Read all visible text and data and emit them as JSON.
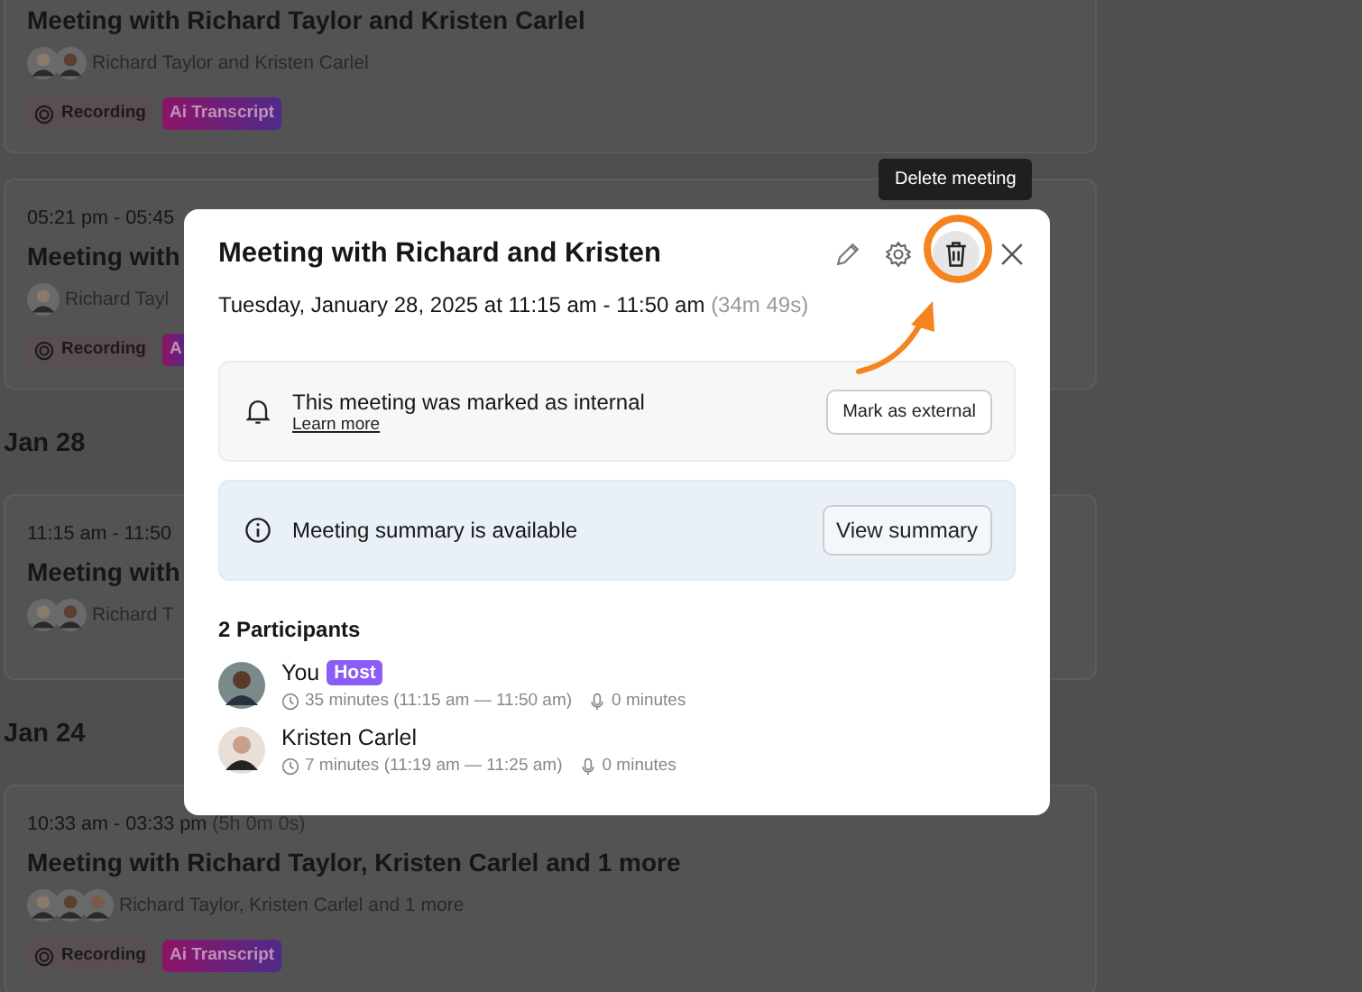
{
  "groups": [
    {
      "cards": [
        {
          "title": "Meeting with Richard Taylor and Kristen Carlel",
          "names": "Richard Taylor and Kristen Carlel",
          "avatars": [
            {
              "kind": "picture"
            },
            {
              "kind": "picture"
            }
          ],
          "tags": [
            {
              "kind": "recording",
              "label": "Recording"
            },
            {
              "kind": "transcript",
              "label": "Ai Transcript"
            }
          ]
        },
        {
          "time": "05:21 pm - 05:45",
          "title": "Meeting with",
          "names": "Richard Tayl",
          "avatars": [
            {
              "kind": "picture"
            }
          ],
          "tags": [
            {
              "kind": "recording",
              "label": "Recording"
            },
            {
              "kind": "transcript",
              "label": "A"
            }
          ]
        }
      ]
    },
    {
      "date": "Jan 28",
      "cards": [
        {
          "time": "11:15 am - 11:50",
          "title": "Meeting with",
          "names": "Richard T",
          "avatars": [
            {
              "kind": "picture"
            },
            {
              "kind": "picture"
            }
          ]
        }
      ]
    },
    {
      "date": "Jan 24",
      "cards": [
        {
          "time": "10:33 am - 03:33 pm",
          "duration": "(5h 0m 0s)",
          "title": "Meeting with Richard Taylor, Kristen Carlel and 1 more",
          "names": "Richard Taylor, Kristen Carlel and 1 more",
          "avatars": [
            {
              "kind": "picture"
            },
            {
              "kind": "picture"
            },
            {
              "kind": "picture"
            }
          ],
          "tags": [
            {
              "kind": "recording",
              "label": "Recording"
            },
            {
              "kind": "transcript",
              "label": "Ai Transcript"
            }
          ]
        }
      ]
    }
  ],
  "dialog": {
    "title": "Meeting with Richard and Kristen",
    "date": "Tuesday, January 28, 2025 at 11:15 am - 11:50 am",
    "duration": "(34m 49s)",
    "actions": [
      {
        "kind": "edit",
        "hovered": false
      },
      {
        "kind": "settings",
        "hovered": false
      },
      {
        "kind": "delete",
        "hovered": true
      },
      {
        "kind": "close",
        "hovered": false
      }
    ],
    "tooltip": "Delete meeting",
    "notices": [
      {
        "kind": "internal",
        "text": "This meeting was marked as internal",
        "link": "Learn more",
        "button": "Mark as external"
      },
      {
        "kind": "summary",
        "text": "Meeting summary is available",
        "button": "View summary"
      }
    ],
    "participants_heading": "2 Participants",
    "participants": [
      {
        "name": "You",
        "badge": "Host",
        "time": "35 minutes (11:15 am — 11:50 am)",
        "speaking": "0 minutes"
      },
      {
        "name": "Kristen Carlel",
        "time": "7 minutes (11:19 am — 11:25 am)",
        "speaking": "0 minutes"
      }
    ]
  }
}
